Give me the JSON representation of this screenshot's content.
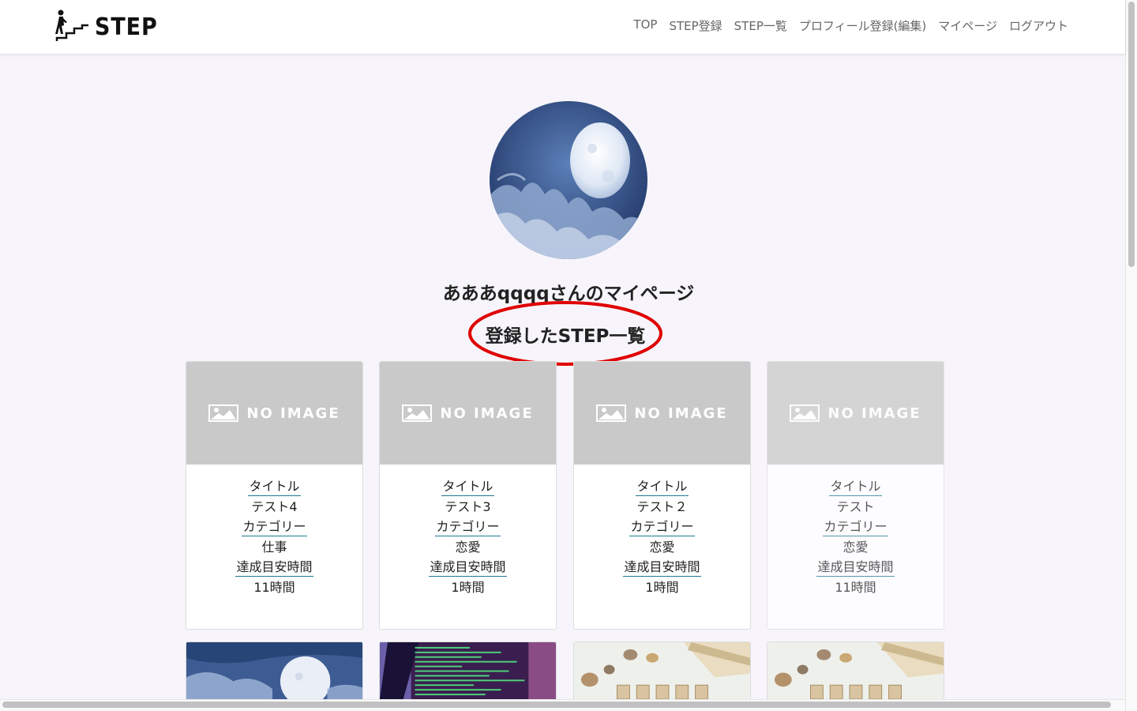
{
  "header": {
    "brand": "STEP",
    "nav": [
      "TOP",
      "STEP登録",
      "STEP一覧",
      "プロフィール登録(編集)",
      "マイページ",
      "ログアウト"
    ]
  },
  "profile": {
    "page_title": "あああqqqqさんのマイページ",
    "section_title": "登録したSTEP一覧"
  },
  "no_image_text": "NO IMAGE",
  "cards": [
    {
      "title_label": "タイトル",
      "title": "テスト4",
      "category_label": "カテゴリー",
      "category": "仕事",
      "time_label": "達成目安時間",
      "time": "11時間"
    },
    {
      "title_label": "タイトル",
      "title": "テスト3",
      "category_label": "カテゴリー",
      "category": "恋愛",
      "time_label": "達成目安時間",
      "time": "1時間"
    },
    {
      "title_label": "タイトル",
      "title": "テスト２",
      "category_label": "カテゴリー",
      "category": "恋愛",
      "time_label": "達成目安時間",
      "time": "1時間"
    },
    {
      "title_label": "タイトル",
      "title": "テスト",
      "category_label": "カテゴリー",
      "category": "恋愛",
      "time_label": "達成目安時間",
      "time": "11時間"
    }
  ],
  "thumbnails": [
    "moon-image",
    "code-screen-image",
    "money-image",
    "money-image"
  ],
  "icons": {
    "logo": "stairs-climber-icon",
    "no_image": "picture-icon"
  },
  "colors": {
    "highlight": "#e00000",
    "underline": "#1f7a96",
    "no_image_bg": "#c9c9c9"
  }
}
